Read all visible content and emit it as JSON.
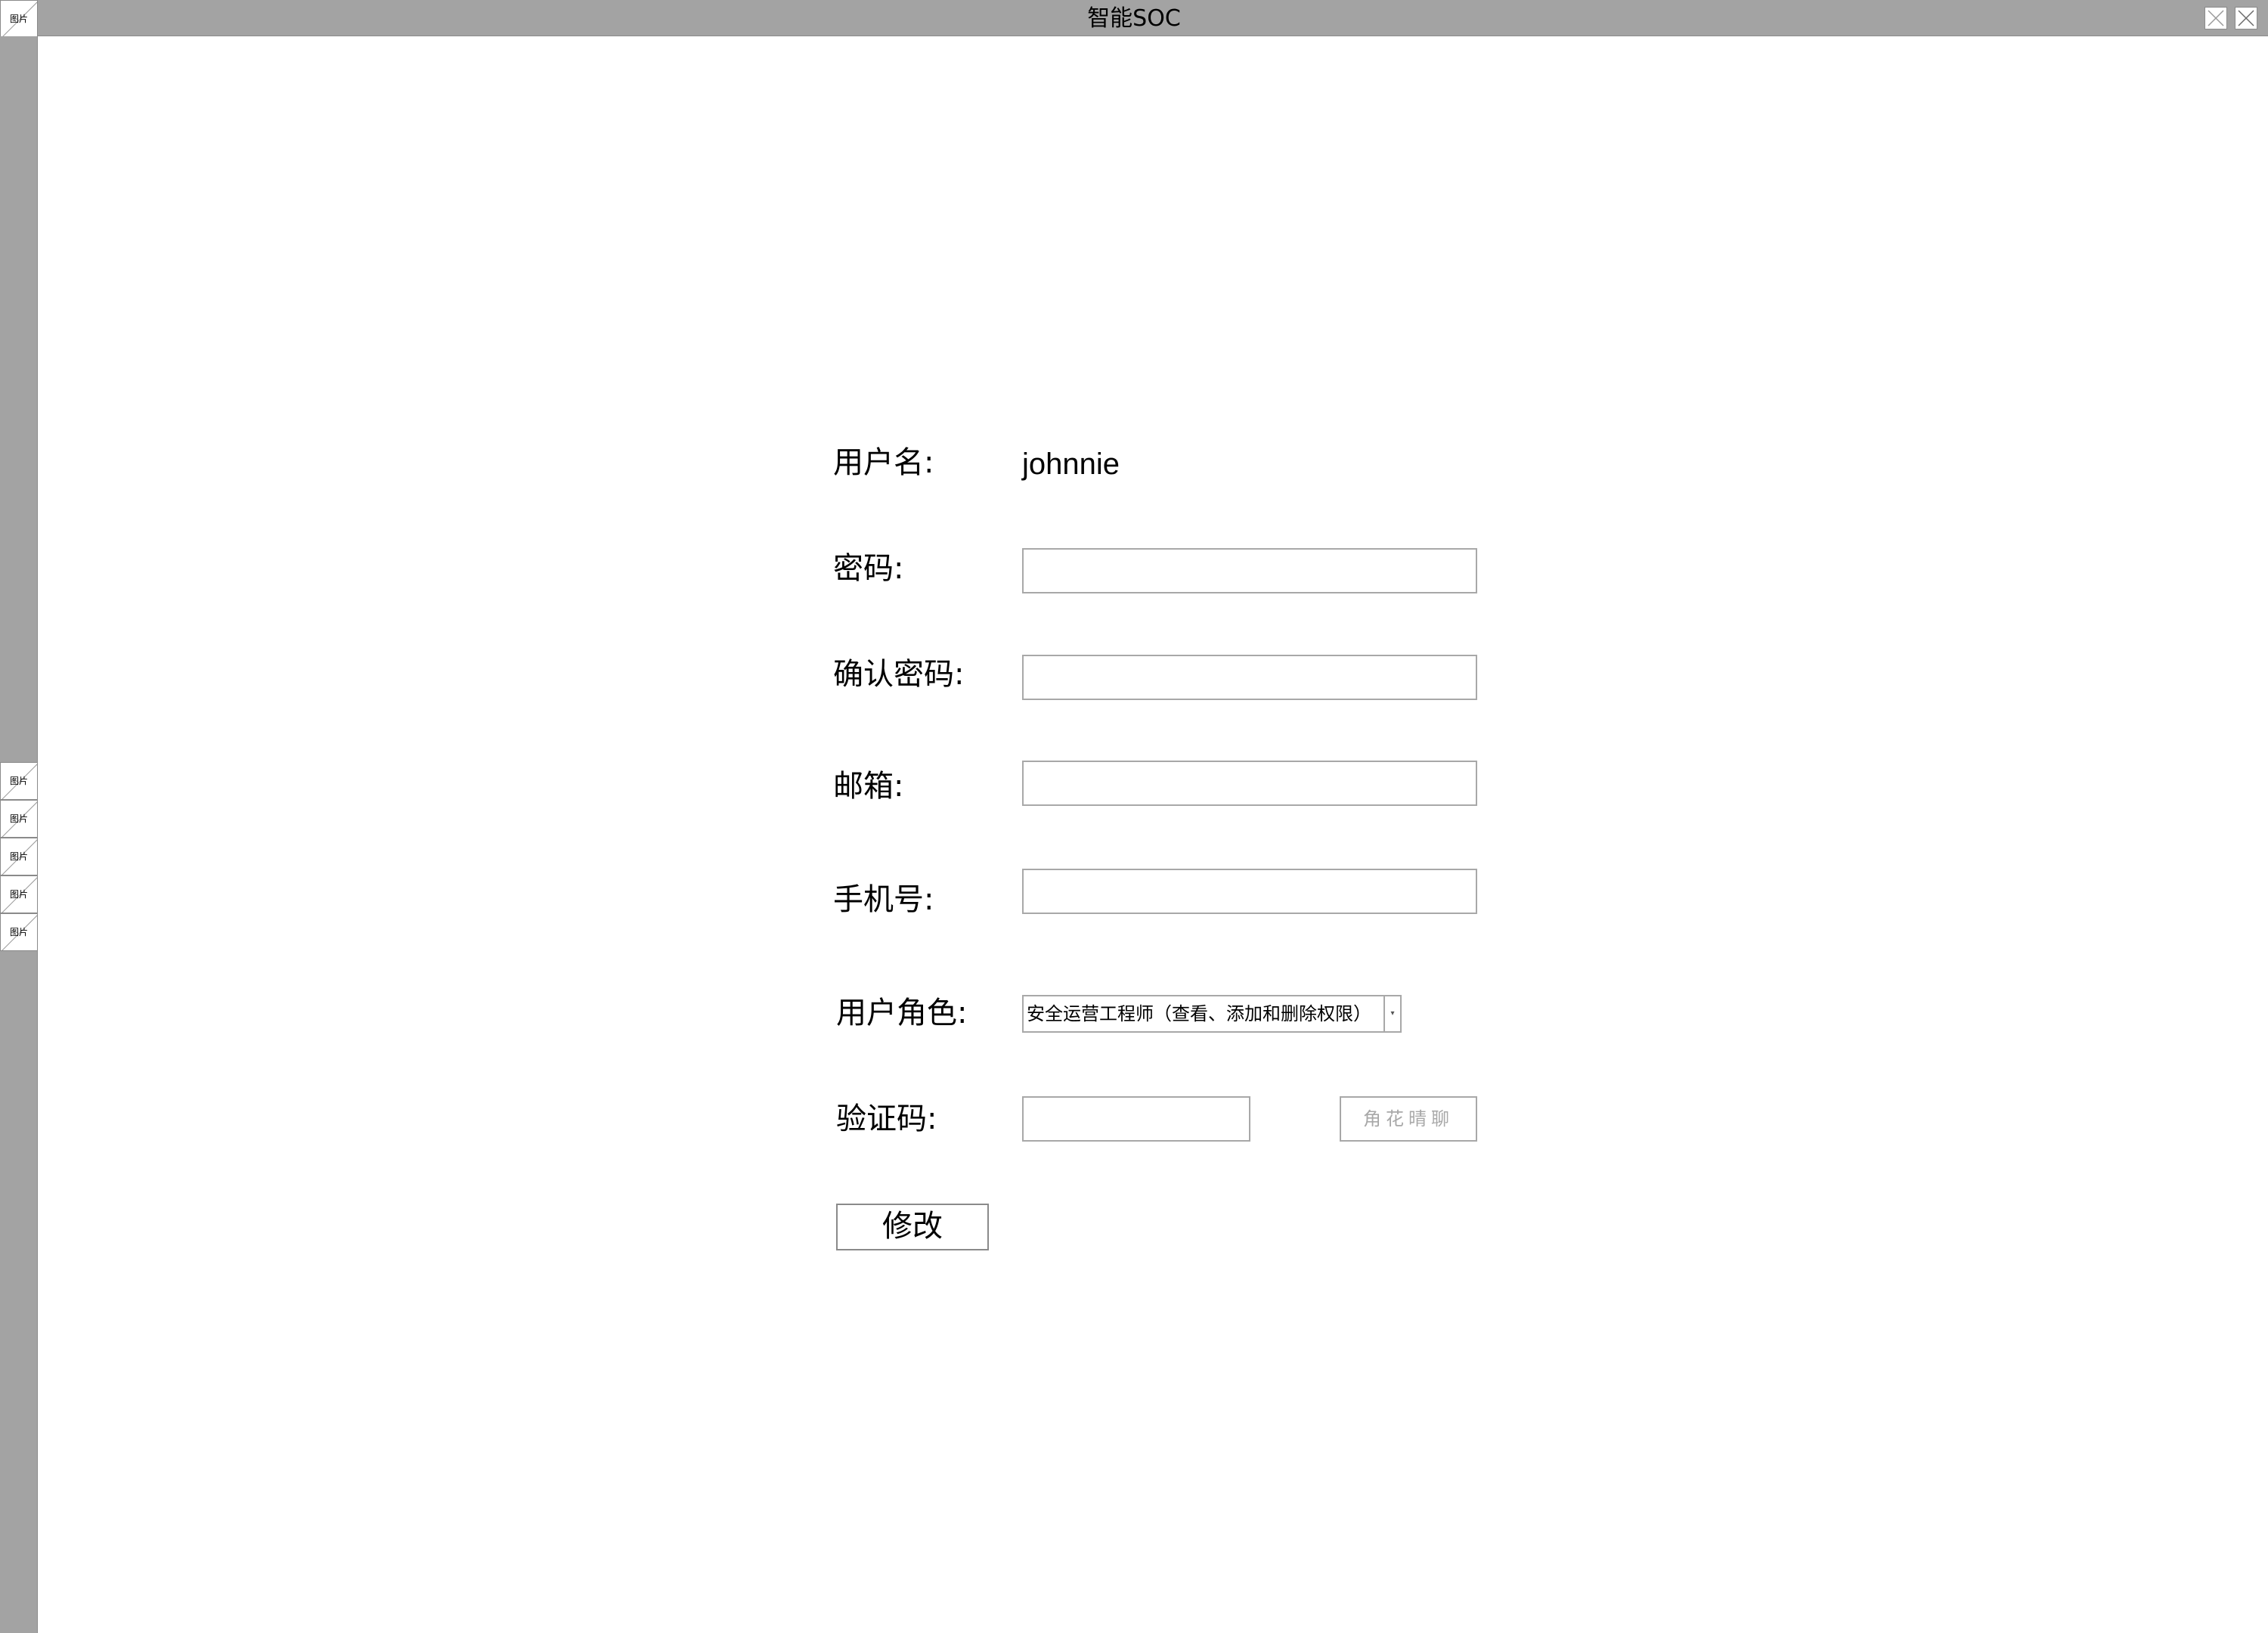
{
  "window": {
    "title": "智能SOC",
    "logo_label": "图片"
  },
  "rail": {
    "items": [
      {
        "label": "图片"
      },
      {
        "label": "图片"
      },
      {
        "label": "图片"
      },
      {
        "label": "图片"
      },
      {
        "label": "图片"
      }
    ]
  },
  "form": {
    "username_label": "用户名:",
    "username_value": "johnnie",
    "password_label": "密码:",
    "password_value": "",
    "confirm_password_label": "确认密码:",
    "confirm_password_value": "",
    "email_label": "邮箱:",
    "email_value": "",
    "phone_label": "手机号:",
    "phone_value": "",
    "role_label": "用户角色:",
    "role_selected": "安全运营工程师（查看、添加和删除权限）",
    "captcha_label": "验证码:",
    "captcha_value": "",
    "captcha_image_text": "角花晴聊",
    "submit_label": "修改"
  }
}
